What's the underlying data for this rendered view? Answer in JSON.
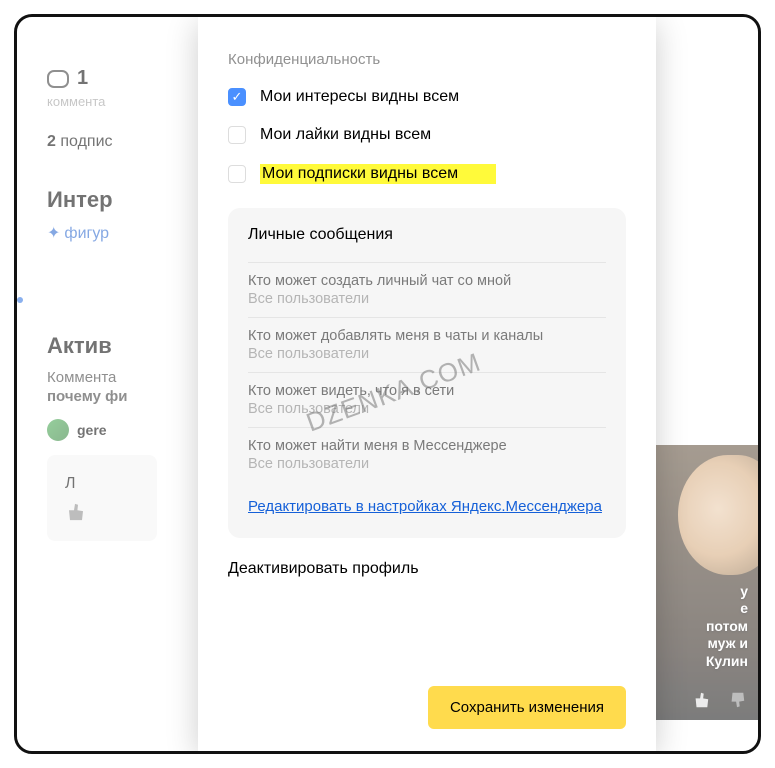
{
  "background": {
    "comment_count": "1",
    "comment_label": "коммента",
    "subscribers_count": "2",
    "subscribers_label": "подпис",
    "interests_title": "Интер",
    "interests_link": "фигур",
    "activity_title": "Актив",
    "activity_line1": "Коммента",
    "activity_line2": "почему фи",
    "username": "gere",
    "like_label": "Л"
  },
  "modal": {
    "privacy_label": "Конфиденциальность",
    "checkboxes": [
      {
        "label": "Мои интересы видны всем",
        "checked": true
      },
      {
        "label": "Мои лайки видны всем",
        "checked": false
      },
      {
        "label": "Мои подписки видны всем",
        "checked": false,
        "highlight": true
      }
    ],
    "pm": {
      "title": "Личные сообщения",
      "items": [
        {
          "q": "Кто может создать личный чат со мной",
          "a": "Все пользователи"
        },
        {
          "q": "Кто может добавлять меня в чаты и каналы",
          "a": "Все пользователи"
        },
        {
          "q": "Кто может видеть, что я в сети",
          "a": "Все пользователи"
        },
        {
          "q": "Кто может найти меня в Мессенджере",
          "a": "Все пользователи"
        }
      ],
      "edit_link": "Редактировать в настройках Яндекс.Мессенджера"
    },
    "deactivate": "Деактивировать профиль",
    "save": "Сохранить изменения"
  },
  "right_card": {
    "text": "у\nе\nпотом\nмуж и\nКулин"
  },
  "watermark": "DZENKA.COM"
}
